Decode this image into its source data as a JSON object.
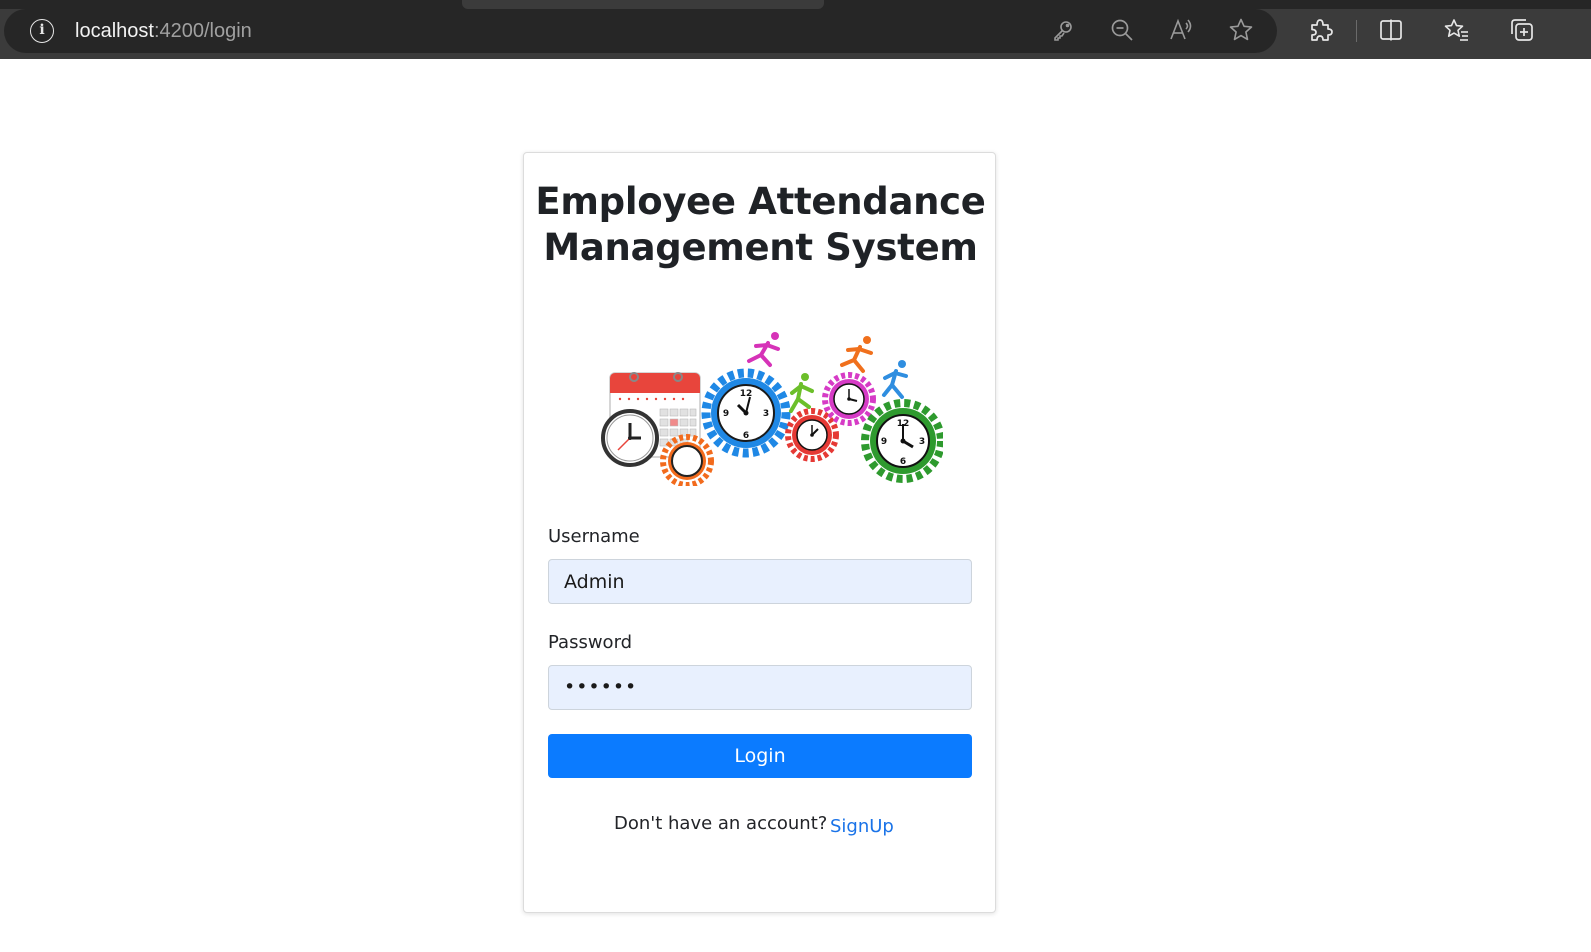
{
  "browser": {
    "url_host": "localhost",
    "url_path": ":4200/login",
    "icons": [
      "info-icon",
      "key-icon",
      "zoom-out-icon",
      "read-aloud-icon",
      "favorite-star-icon",
      "extensions-icon",
      "split-screen-icon",
      "favorites-icon",
      "collections-icon"
    ]
  },
  "login": {
    "title_line1": "Employee Attendance",
    "title_line2": "Management System",
    "username_label": "Username",
    "username_value": "Admin",
    "password_label": "Password",
    "password_value": "••••••",
    "login_button": "Login",
    "signup_prompt": "Don't have an account?",
    "signup_link": "SignUp"
  },
  "colors": {
    "primary_button": "#0b7bff",
    "link": "#1a73e8",
    "input_fill": "#e8f0fe",
    "chrome_bg": "#3b3b3b"
  }
}
